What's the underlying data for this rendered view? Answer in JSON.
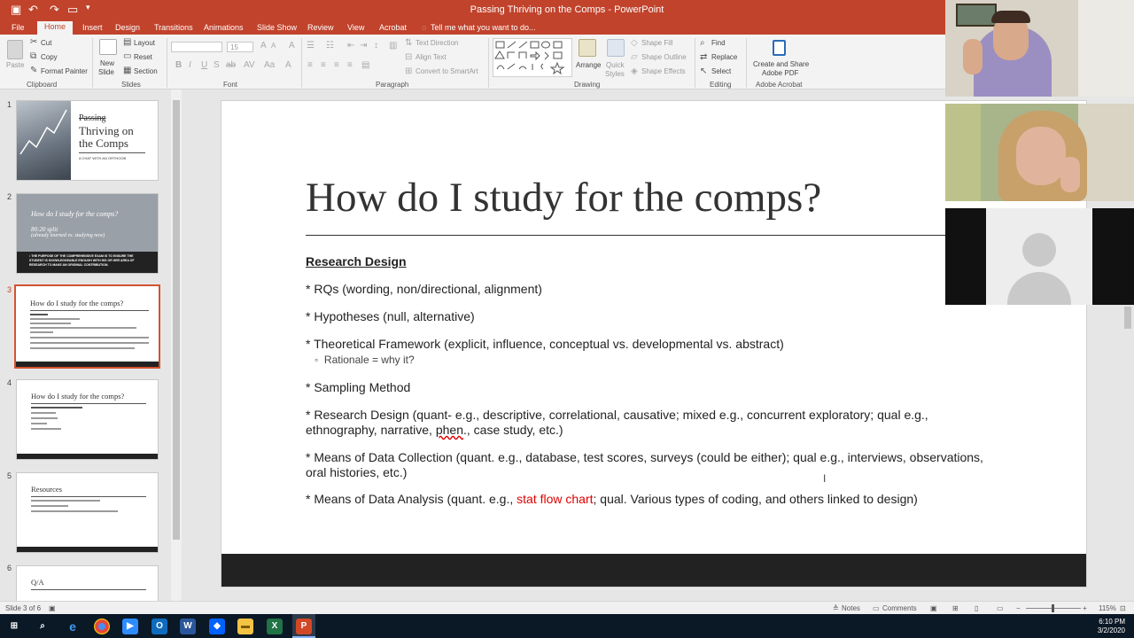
{
  "window": {
    "title": "Passing Thriving on the Comps - PowerPoint"
  },
  "colors": {
    "accent": "#c1432c",
    "selected": "#d35230",
    "red_text": "#e00000"
  },
  "tabs": [
    "File",
    "Home",
    "Insert",
    "Design",
    "Transitions",
    "Animations",
    "Slide Show",
    "Review",
    "View",
    "Acrobat",
    "Tell me what you want to do..."
  ],
  "ribbon": {
    "clipboard": {
      "paste": "Paste",
      "cut": "Cut",
      "copy": "Copy",
      "format_painter": "Format Painter",
      "label": "Clipboard"
    },
    "slides": {
      "new_slide": "New",
      "new_slide2": "Slide",
      "layout": "Layout",
      "reset": "Reset",
      "section": "Section",
      "label": "Slides"
    },
    "font": {
      "size": "15",
      "label": "Font"
    },
    "paragraph": {
      "text_direction": "Text Direction",
      "align_text": "Align Text",
      "convert_smartart": "Convert to SmartArt",
      "label": "Paragraph"
    },
    "drawing": {
      "arrange": "Arrange",
      "quick_styles": "Quick",
      "quick_styles2": "Styles",
      "shape_fill": "Shape Fill",
      "shape_outline": "Shape Outline",
      "shape_effects": "Shape Effects",
      "label": "Drawing"
    },
    "editing": {
      "find": "Find",
      "replace": "Replace",
      "select": "Select",
      "label": "Editing"
    },
    "acrobat": {
      "create_share": "Create and Share",
      "adobe_pdf": "Adobe PDF",
      "label": "Adobe Acrobat"
    }
  },
  "thumbnails": [
    {
      "num": "1",
      "title_strike": "Passing",
      "title1": "Thriving on",
      "title2": "the Comps",
      "sub": "A CHAT WITH AN ORTHOOB"
    },
    {
      "num": "2",
      "title": "How do I study for the comps?",
      "line1": "80:20 split",
      "line2": "(already learned vs. studying now)",
      "body": "• THE PURPOSE OF THE COMPREHENSIVE EXAM IS TO ENSURE THE STUDENT IS KNOWLEDGEABLE ENOUGH WITH HIS OR HER AREA OF RESEARCH TO MAKE AN ORIGINAL CONTRIBUTION."
    },
    {
      "num": "3",
      "title": "How do I study for the comps?"
    },
    {
      "num": "4",
      "title": "How do I study for the comps?"
    },
    {
      "num": "5",
      "title": "Resources"
    },
    {
      "num": "6",
      "title": "Q/A"
    }
  ],
  "slide": {
    "heading": "How do I study for the comps?",
    "section": "Research Design",
    "b1": "* RQs (wording, non/directional, alignment)",
    "b2": "* Hypotheses (null, alternative)",
    "b3": "* Theoretical Framework (explicit, influence, conceptual vs. developmental vs. abstract)",
    "b3sub": "Rationale = why it?",
    "b4": "* Sampling Method",
    "b5a": "* Research Design (quant- e.g., descriptive, correlational, causative; mixed e.g., concurrent exploratory; qual e.g.,",
    "b5b_pre": "ethnography, narrative, ",
    "b5b_squig": "phen",
    "b5b_post": "., case study, etc.)",
    "b6a": "* Means of Data Collection (quant. e.g., database, test scores, surveys (could be either); qual e.g., interviews, observations,",
    "b6b": "oral histories, etc.)",
    "b7_pre": "* Means of Data Analysis (quant. e.g., ",
    "b7_red": "stat flow chart",
    "b7_post": "; qual. Various types of coding, and others linked to design)"
  },
  "status": {
    "slide_of": "Slide 3 of 6",
    "notes": "Notes",
    "comments": "Comments",
    "zoom": "115%"
  },
  "clock": {
    "time": "6:10 PM",
    "date": "3/2/2020"
  }
}
